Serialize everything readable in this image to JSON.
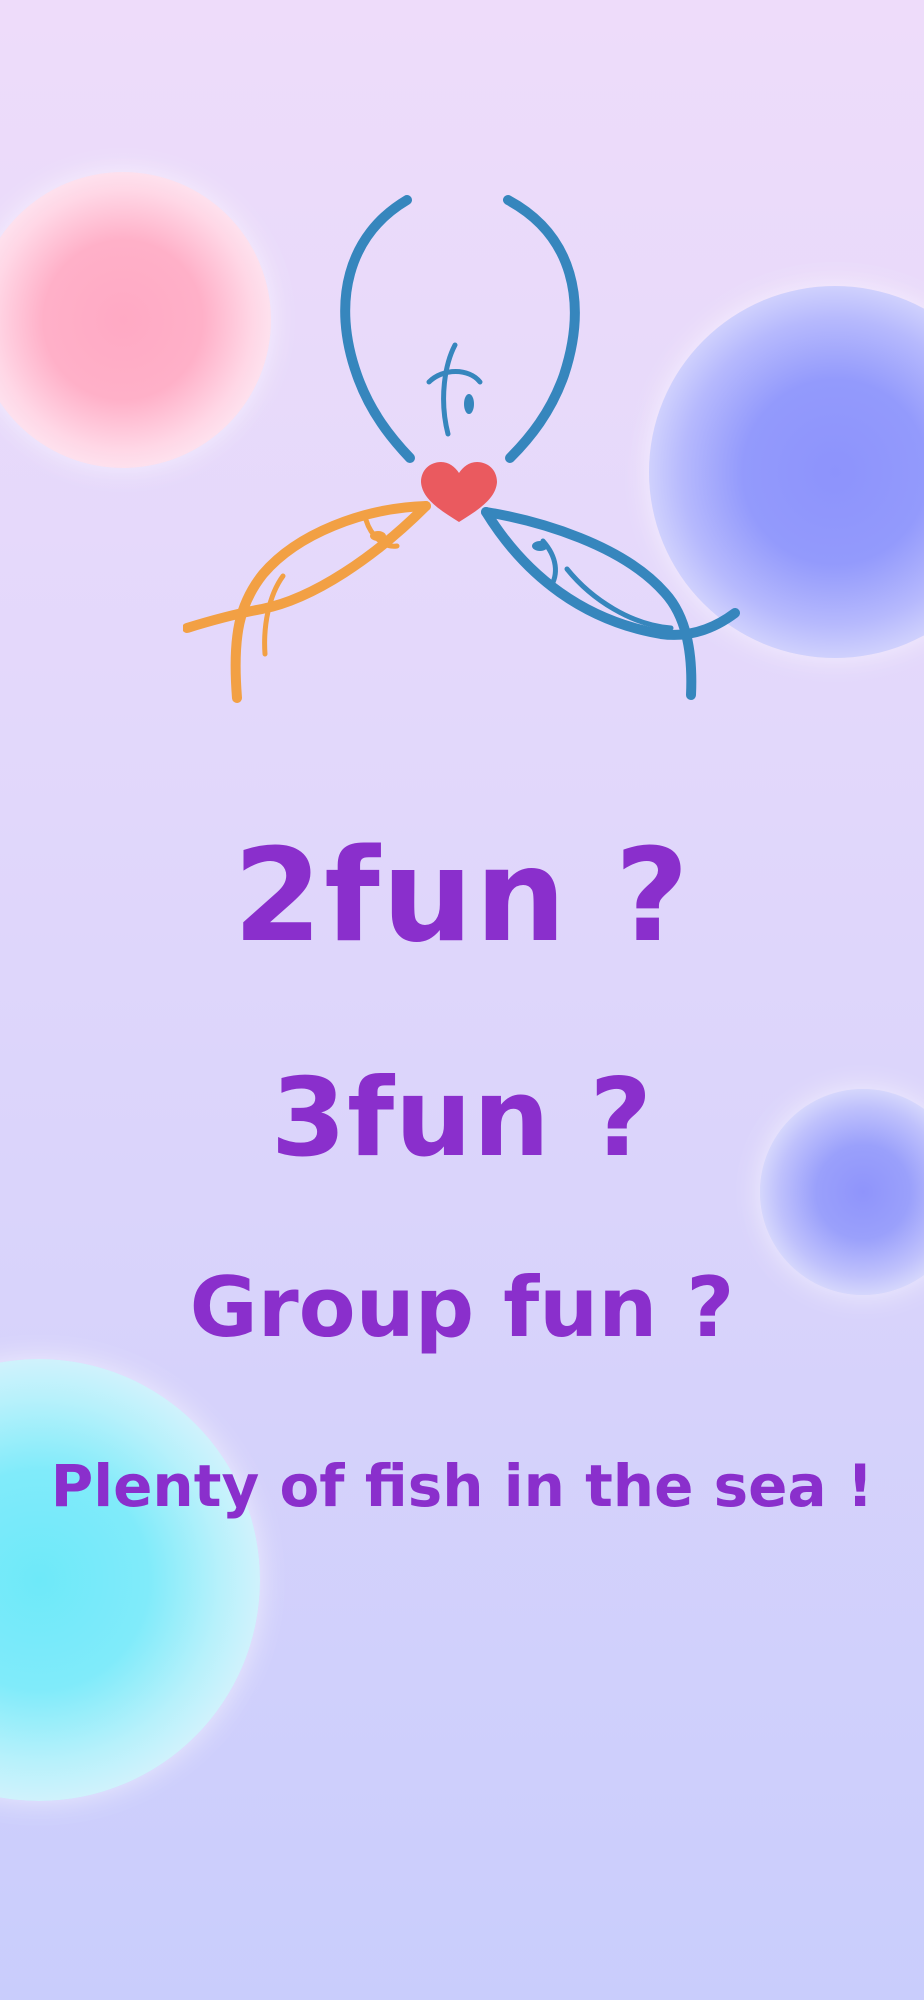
{
  "screen": {
    "logo": {
      "icon": "three-fish-heart-logo",
      "colors": {
        "fish_top": "#3686bd",
        "fish_left": "#f2a044",
        "fish_right": "#3686bd",
        "heart": "#ea5a5f"
      }
    },
    "headlines": [
      "2fun ?",
      "3fun ?",
      "Group fun ?",
      "Plenty of fish in the sea !"
    ],
    "colors": {
      "headline": "#8a2fcc",
      "bubble_pink": "#ffa9c4",
      "bubble_blue": "#8f94fb",
      "bubble_cyan": "#6ee9f9"
    }
  }
}
